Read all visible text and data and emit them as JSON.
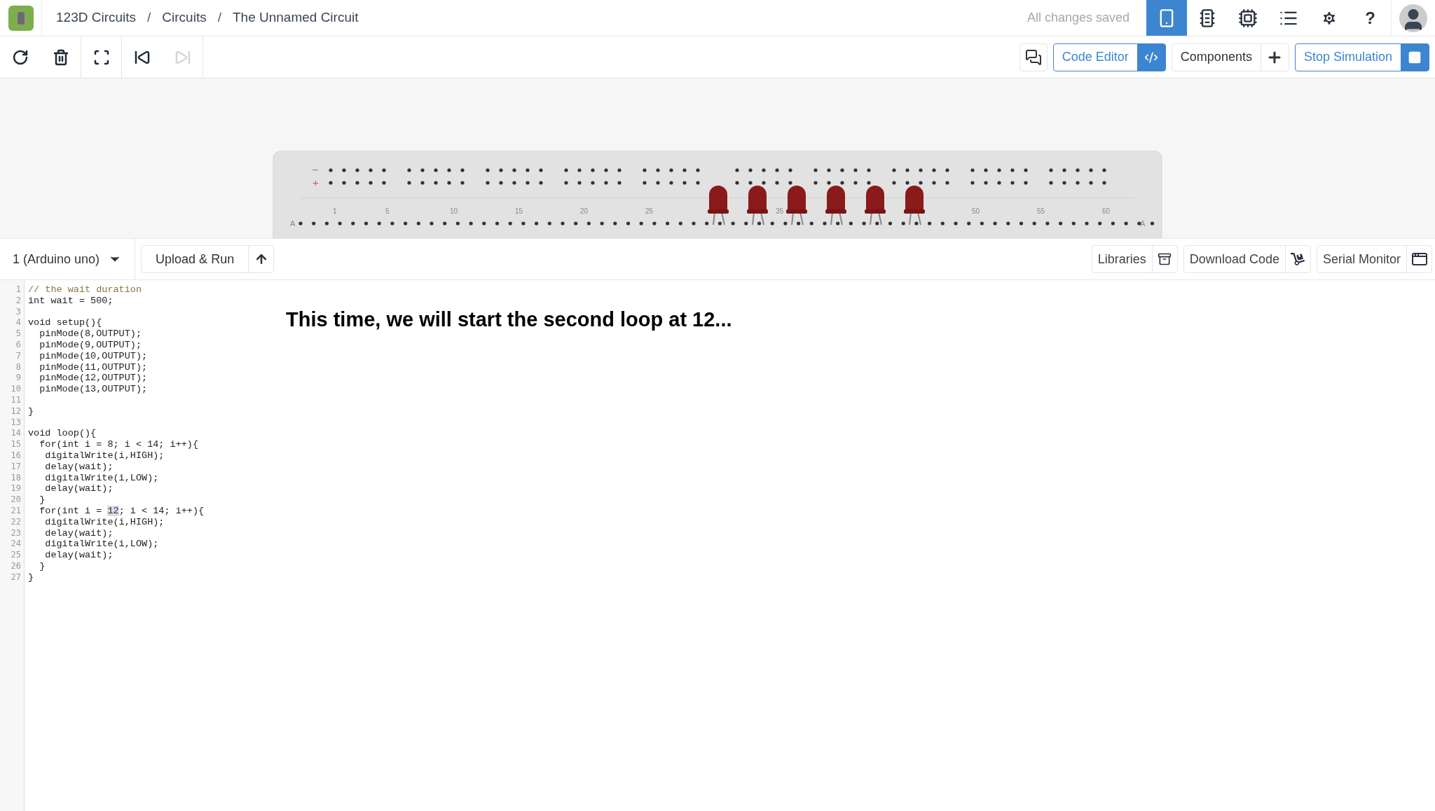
{
  "breadcrumb": [
    {
      "kind": "link",
      "text": "123D Circuits"
    },
    {
      "kind": "separator",
      "text": "/"
    },
    {
      "kind": "link",
      "text": "Circuits"
    },
    {
      "kind": "separator",
      "text": "/"
    },
    {
      "kind": "link",
      "text": "The Unnamed Circuit"
    }
  ],
  "save_status": "All changes saved",
  "view_tabs": [
    {
      "kind": "breadboard",
      "selected": true
    },
    {
      "kind": "schematic",
      "selected": false
    },
    {
      "kind": "pcb",
      "selected": false
    },
    {
      "kind": "list",
      "selected": false
    }
  ],
  "help_label": "?",
  "toolbar": [
    {
      "kind": "rotate",
      "disabled": false
    },
    {
      "kind": "delete",
      "disabled": false
    },
    {
      "kind": "fit",
      "disabled": false
    },
    {
      "kind": "step-back",
      "disabled": false
    },
    {
      "kind": "step-forward",
      "disabled": true
    }
  ],
  "action_buttons": [
    {
      "kind": "code",
      "label": "Code Editor",
      "selected": true
    },
    {
      "kind": "components",
      "label": "Components",
      "selected": false
    },
    {
      "kind": "simulation",
      "label": "Stop Simulation",
      "selected": true
    }
  ],
  "breadboard": {
    "rail_labels": [
      "−",
      "+"
    ],
    "row_labels": [
      "A",
      "A"
    ],
    "column_labels": [
      "1",
      "5",
      "10",
      "15",
      "20",
      "25",
      "35",
      "50",
      "55",
      "60"
    ],
    "leds": [
      {
        "kind": "led"
      },
      {
        "kind": "led"
      },
      {
        "kind": "led"
      },
      {
        "kind": "led"
      },
      {
        "kind": "led"
      },
      {
        "kind": "led"
      }
    ]
  },
  "code_panel": {
    "board": "1 (Arduino uno)",
    "upload": "Upload & Run",
    "tools": [
      {
        "kind": "libraries",
        "label": "Libraries"
      },
      {
        "kind": "download",
        "label": "Download Code"
      },
      {
        "kind": "serial",
        "label": "Serial Monitor"
      }
    ]
  },
  "code_lines": [
    {
      "number": "1",
      "parts": [
        {
          "text": "// the wait duration",
          "kind": "comment"
        }
      ]
    },
    {
      "number": "2",
      "parts": [
        {
          "text": "int wait = 500;",
          "kind": "code"
        }
      ]
    },
    {
      "number": "3"
    },
    {
      "number": "4",
      "parts": [
        {
          "text": "void setup(){",
          "kind": "code"
        }
      ]
    },
    {
      "number": "5",
      "parts": [
        {
          "text": "  pinMode(8,OUTPUT);",
          "kind": "code"
        }
      ]
    },
    {
      "number": "6",
      "parts": [
        {
          "text": "  pinMode(9,OUTPUT);",
          "kind": "code"
        }
      ]
    },
    {
      "number": "7",
      "parts": [
        {
          "text": "  pinMode(10,OUTPUT);",
          "kind": "code"
        }
      ]
    },
    {
      "number": "8",
      "parts": [
        {
          "text": "  pinMode(11,OUTPUT);",
          "kind": "code"
        }
      ]
    },
    {
      "number": "9",
      "parts": [
        {
          "text": "  pinMode(12,OUTPUT);",
          "kind": "code"
        }
      ]
    },
    {
      "number": "10",
      "parts": [
        {
          "text": "  pinMode(13,OUTPUT);",
          "kind": "code"
        }
      ]
    },
    {
      "number": "11"
    },
    {
      "number": "12",
      "parts": [
        {
          "text": "}",
          "kind": "code"
        }
      ]
    },
    {
      "number": "13"
    },
    {
      "number": "14",
      "parts": [
        {
          "text": "void loop(){",
          "kind": "code"
        }
      ]
    },
    {
      "number": "15",
      "parts": [
        {
          "text": "  for(int i = 8; i < 14; i++){",
          "kind": "code"
        }
      ]
    },
    {
      "number": "16",
      "parts": [
        {
          "text": "   digitalWrite(i,HIGH);",
          "kind": "code"
        }
      ]
    },
    {
      "number": "17",
      "parts": [
        {
          "text": "   delay(wait);",
          "kind": "code"
        }
      ]
    },
    {
      "number": "18",
      "parts": [
        {
          "text": "   digitalWrite(i,LOW);",
          "kind": "code"
        }
      ]
    },
    {
      "number": "19",
      "parts": [
        {
          "text": "   delay(wait);",
          "kind": "code"
        }
      ]
    },
    {
      "number": "20",
      "parts": [
        {
          "text": "  }",
          "kind": "code"
        }
      ]
    },
    {
      "number": "21",
      "parts": [
        {
          "text": "  for(int i = ",
          "kind": "code"
        },
        {
          "text": "12",
          "kind": "selection"
        },
        {
          "text": "; i < 14; i++){",
          "kind": "code"
        }
      ]
    },
    {
      "number": "22",
      "parts": [
        {
          "text": "   digitalWrite(i,HIGH);",
          "kind": "code"
        }
      ]
    },
    {
      "number": "23",
      "parts": [
        {
          "text": "   delay(wait);",
          "kind": "code"
        }
      ]
    },
    {
      "number": "24",
      "parts": [
        {
          "text": "   digitalWrite(i,LOW);",
          "kind": "code"
        }
      ]
    },
    {
      "number": "25",
      "parts": [
        {
          "text": "   delay(wait);",
          "kind": "code"
        }
      ]
    },
    {
      "number": "26",
      "parts": [
        {
          "text": "  }",
          "kind": "code"
        }
      ]
    },
    {
      "number": "27",
      "parts": [
        {
          "text": "}",
          "kind": "code"
        }
      ]
    }
  ],
  "caption": "This time, we will start the second loop at 12..."
}
